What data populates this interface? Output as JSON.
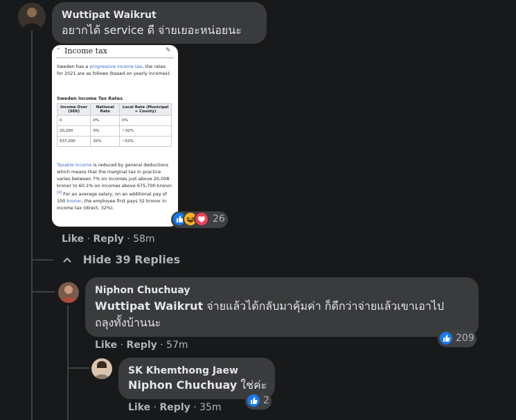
{
  "comment1": {
    "author": "Wuttipat Waikrut",
    "text": "อยากได้ service ดี จ่ายเยอะหน่อยนะ",
    "actions": {
      "like": "Like",
      "sep1": "·",
      "reply": "Reply",
      "sep2": "·",
      "time": "58m"
    },
    "reactions": {
      "count": "26",
      "types": [
        "like",
        "haha",
        "love"
      ]
    },
    "attachment": {
      "heading": "Income tax",
      "intro_pre": "Sweden has a ",
      "intro_link": "progressive income tax",
      "intro_post": ", the rates for 2021 are as follows (based on yearly incomes):",
      "table_title": "Sweden Income Tax Rates",
      "table_headers": [
        "Income Over (SEK)",
        "National Rate",
        "Local Rate (Municipal + County)"
      ],
      "table_rows": [
        [
          "0",
          "0%",
          "0%"
        ],
        [
          "20,200",
          "0%",
          "~32%"
        ],
        [
          "537,200",
          "20%",
          "~52%"
        ]
      ],
      "para_link": "Taxable income",
      "para_text": " is reduced by general deductions which means that the marginal tax in practice varies between 7% on incomes just above 20,008 kronor to 60.1% on incomes above 675,700 kronor.",
      "para_ref": "[4]",
      "para_text2": " For an average salary, on an additional pay of 100 ",
      "para_link2": "kronor",
      "para_text3": ", the employee first pays 32 kronor in income tax (direct, 32%)."
    }
  },
  "replies_toggle": {
    "label": "Hide 39 Replies"
  },
  "reply1": {
    "author": "Niphon Chuchuay",
    "mention": "Wuttipat Waikrut",
    "text_line1": " จ่ายแล้วได้กลับมาคุ้มค่า ก็ดีกว่าจ่ายแล้วเขาเอาไป",
    "text_line2": "ถลุงทั้งบ้านนะ",
    "actions": {
      "like": "Like",
      "sep1": "·",
      "reply": "Reply",
      "sep2": "·",
      "time": "57m"
    },
    "reactions": {
      "count": "209",
      "types": [
        "like"
      ]
    }
  },
  "reply2": {
    "author": "SK Khemthong Jaew",
    "mention": "Niphon Chuchuay",
    "text": " ใช่ค่ะ",
    "actions": {
      "like": "Like",
      "sep1": "·",
      "reply": "Reply",
      "sep2": "·",
      "time": "35m"
    },
    "reactions": {
      "count": "2",
      "types": [
        "like"
      ]
    }
  },
  "colors": {
    "background": "#18191a",
    "bubble": "#3a3b3c",
    "text": "#e4e6eb",
    "secondary_text": "#b0b3b8",
    "like_blue": "#1877f2"
  }
}
